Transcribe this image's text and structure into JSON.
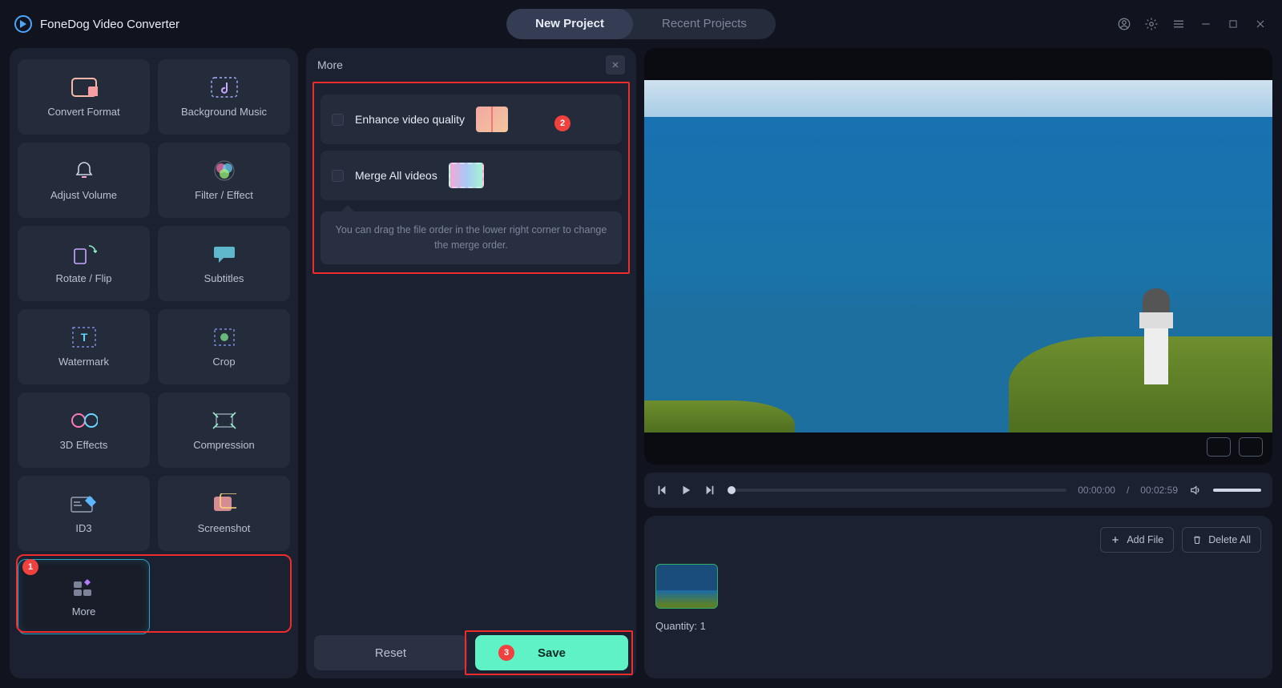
{
  "app": {
    "title": "FoneDog Video Converter"
  },
  "tabs": {
    "new_project": "New Project",
    "recent": "Recent Projects"
  },
  "tools": {
    "convert": "Convert Format",
    "bgmusic": "Background Music",
    "volume": "Adjust Volume",
    "filter": "Filter / Effect",
    "rotate": "Rotate / Flip",
    "subtitles": "Subtitles",
    "watermark": "Watermark",
    "crop": "Crop",
    "threeD": "3D Effects",
    "compression": "Compression",
    "id3": "ID3",
    "screenshot": "Screenshot",
    "more": "More"
  },
  "more_panel": {
    "title": "More",
    "enhance": "Enhance video quality",
    "merge": "Merge All videos",
    "hint": "You can drag the file order in the lower right corner to change the merge order.",
    "reset": "Reset",
    "save": "Save"
  },
  "annotations": {
    "n1": "1",
    "n2": "2",
    "n3": "3"
  },
  "player": {
    "current": "00:00:00",
    "total": "00:02:59"
  },
  "queue": {
    "add_file": "Add File",
    "delete_all": "Delete All",
    "quantity_label": "Quantity:",
    "quantity_value": "1"
  }
}
